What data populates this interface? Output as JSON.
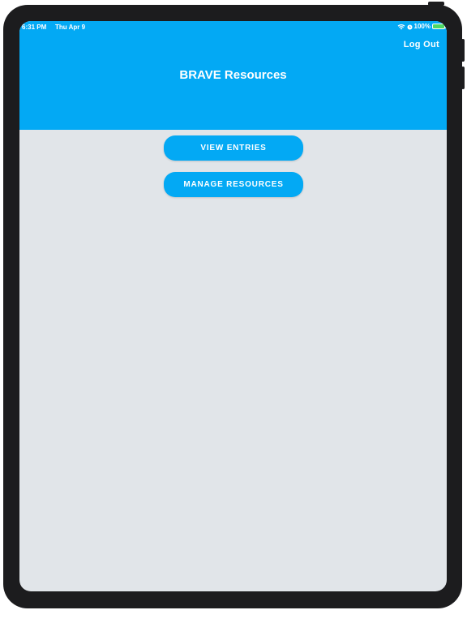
{
  "status_bar": {
    "time": "6:31 PM",
    "date": "Thu Apr 9",
    "battery": "100%",
    "wifi_icon": "wifi-icon",
    "alarm_icon": "alarm-icon",
    "battery_icon": "battery-charging-icon"
  },
  "header": {
    "title": "BRAVE Resources",
    "logout_label": "Log Out"
  },
  "main": {
    "buttons": [
      {
        "label": "VIEW ENTRIES"
      },
      {
        "label": "MANAGE RESOURCES"
      }
    ]
  },
  "colors": {
    "accent": "#03a9f4",
    "background": "#e1e5e9",
    "device_frame": "#1c1c1e"
  }
}
